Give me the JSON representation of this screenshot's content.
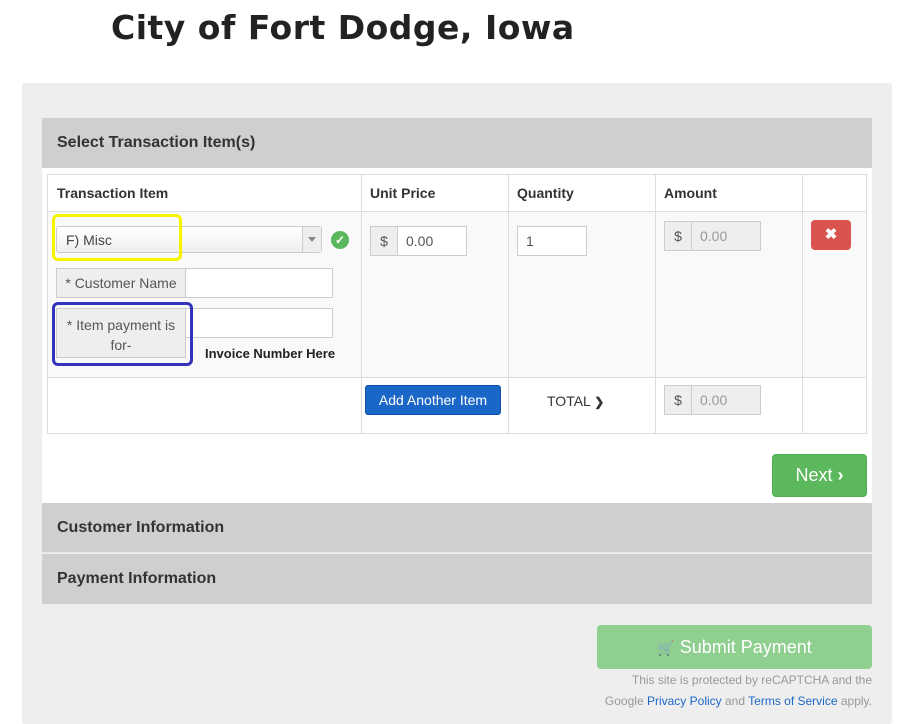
{
  "page": {
    "title": "City of Fort Dodge, Iowa"
  },
  "sections": {
    "select_items": "Select Transaction Item(s)",
    "customer_info": "Customer Information",
    "payment_info": "Payment Information"
  },
  "table": {
    "headers": {
      "item": "Transaction Item",
      "unit_price": "Unit Price",
      "quantity": "Quantity",
      "amount": "Amount"
    },
    "row": {
      "item_selected": "F) Misc",
      "customer_name_label": "* Customer Name",
      "customer_name_value": "",
      "payment_for_label_1": "* Item payment is",
      "payment_for_label_2": "for-",
      "payment_for_value": "",
      "invoice_hint": "Invoice Number Here",
      "currency": "$",
      "unit_price_value": "0.00",
      "quantity_value": "1",
      "amount_placeholder": "0.00",
      "delete_glyph": "✖"
    },
    "footer": {
      "add_item_label": "Add Another Item",
      "total_label": "TOTAL",
      "total_arrow": "❯",
      "currency": "$",
      "total_placeholder": "0.00"
    }
  },
  "buttons": {
    "next_label": "Next",
    "next_glyph": "›",
    "submit_glyph": "🛒",
    "submit_label": "Submit Payment"
  },
  "recaptcha": {
    "line1": "This site is protected by reCAPTCHA and the",
    "prefix": "Google",
    "privacy": "Privacy Policy",
    "and": "and",
    "terms": "Terms of Service",
    "suffix": "apply."
  },
  "colors": {
    "accent_blue": "#1b67c8",
    "success_green": "#5cb85c",
    "danger_red": "#d9534f",
    "highlight_yellow": "#f5f500",
    "highlight_blue": "#3333bb"
  }
}
